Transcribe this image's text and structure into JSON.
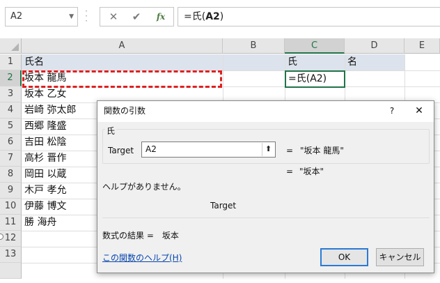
{
  "formula_bar": {
    "name_box": "A2",
    "cancel_icon": "✕",
    "enter_icon": "✔",
    "fx_icon": "fx",
    "formula_prefix": "=氏(",
    "formula_ref": "A2",
    "formula_suffix": ")"
  },
  "grid": {
    "columns": [
      "A",
      "B",
      "C",
      "D",
      "E"
    ],
    "rows": [
      "1",
      "2",
      "3",
      "4",
      "5",
      "6",
      "7",
      "8",
      "9",
      "10",
      "11",
      "12",
      "13"
    ],
    "header_row": {
      "a": "氏名",
      "c": "氏",
      "d": "名"
    },
    "names": [
      "坂本 龍馬",
      "坂本 乙女",
      "岩崎 弥太郎",
      "西郷 隆盛",
      "吉田 松陰",
      "高杉 晋作",
      "岡田 以蔵",
      "木戸 孝允",
      "伊藤 博文",
      "勝 海舟"
    ],
    "active_cell_text": "=氏(A2)"
  },
  "dialog": {
    "title": "関数の引数",
    "help_icon": "?",
    "close_icon": "✕",
    "function_name": "氏",
    "arg_label": "Target",
    "arg_value": "A2",
    "ref_icon": "⬆",
    "arg_eq": "=",
    "arg_result": "\"坂本 龍馬\"",
    "result_eq": "=",
    "result_value": "\"坂本\"",
    "no_help": "ヘルプがありません。",
    "arg_description": "Target",
    "formula_result": "数式の結果 =　坂本",
    "help_link": "この関数のヘルプ(H)",
    "ok": "OK",
    "cancel": "キャンセル"
  }
}
